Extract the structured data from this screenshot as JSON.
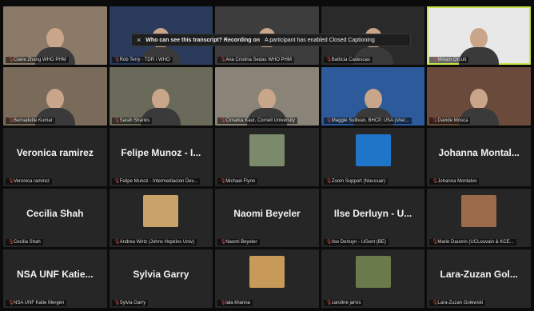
{
  "banner": {
    "close": "×",
    "question": "Who can see this transcript? Recording on",
    "message": "A participant has enabled Closed Captioning"
  },
  "tiles": [
    {
      "label": "Claire Zhang WHO PHM",
      "kind": "video",
      "bg": "#8b7a68"
    },
    {
      "label": "Rob Terry · TDR / WHO",
      "kind": "video",
      "bg": "#2a3a5a"
    },
    {
      "label": "Ana Cristina Sedas WHO PHM",
      "kind": "video",
      "bg": "#3d3d3d"
    },
    {
      "label": "Batticia Cadescas",
      "kind": "video",
      "bg": "#2a2a2a"
    },
    {
      "label": "Miriam Orcutt",
      "kind": "video",
      "bg": "#e8e8e8",
      "active": true
    },
    {
      "label": "Bernadette Kumar",
      "kind": "video",
      "bg": "#7a6a5a"
    },
    {
      "label": "Sarah Shanks",
      "kind": "video",
      "bg": "#6a6a5a"
    },
    {
      "label": "Cimarka Kaur, Cornell University",
      "kind": "video",
      "bg": "#8a8478"
    },
    {
      "label": "Maggie Sullivan, BHCP, USA (she/...",
      "kind": "video",
      "bg": "#2c5a9a"
    },
    {
      "label": "Davide Mosca",
      "kind": "video",
      "bg": "#6a4a3a"
    },
    {
      "label": "Veronica ramirez",
      "big": "Veronica ramirez",
      "kind": "name"
    },
    {
      "label": "Felipe Munoz - Intermediacion Dev...",
      "big": "Felipe Munoz - I...",
      "kind": "name"
    },
    {
      "label": "Michael Flynn",
      "kind": "thumb",
      "thumbBg": "#7a8a6a"
    },
    {
      "label": "Zoom Support (Noussair)",
      "kind": "thumb",
      "thumbBg": "#1f75c7"
    },
    {
      "label": "Johanna Montalvo",
      "big": "Johanna Montal...",
      "kind": "name"
    },
    {
      "label": "Cecilia Shah",
      "big": "Cecilia Shah",
      "kind": "name"
    },
    {
      "label": "Andrea Wirtz (Johns Hopkins Univ)",
      "kind": "thumb",
      "thumbBg": "#c9a26a"
    },
    {
      "label": "Naomi Beyeler",
      "big": "Naomi Beyeler",
      "kind": "name"
    },
    {
      "label": "Ilse Derluyn - UGent (BE)",
      "big": "Ilse Derluyn - U...",
      "kind": "name"
    },
    {
      "label": "Marie Dauvrin (UCLouvain & KCE...",
      "kind": "thumb",
      "thumbBg": "#9a6a4a"
    },
    {
      "label": "NSA UNF Katie Mergen",
      "big": "NSA UNF Katie...",
      "kind": "name"
    },
    {
      "label": "Sylvia Garry",
      "big": "Sylvia Garry",
      "kind": "name"
    },
    {
      "label": "lala khanna",
      "kind": "thumb",
      "thumbBg": "#c89a5a"
    },
    {
      "label": "caroline jarvis",
      "kind": "thumb",
      "thumbBg": "#6a7a4a"
    },
    {
      "label": "Lara-Zuzan Golewski",
      "big": "Lara-Zuzan Gol...",
      "kind": "name"
    }
  ]
}
